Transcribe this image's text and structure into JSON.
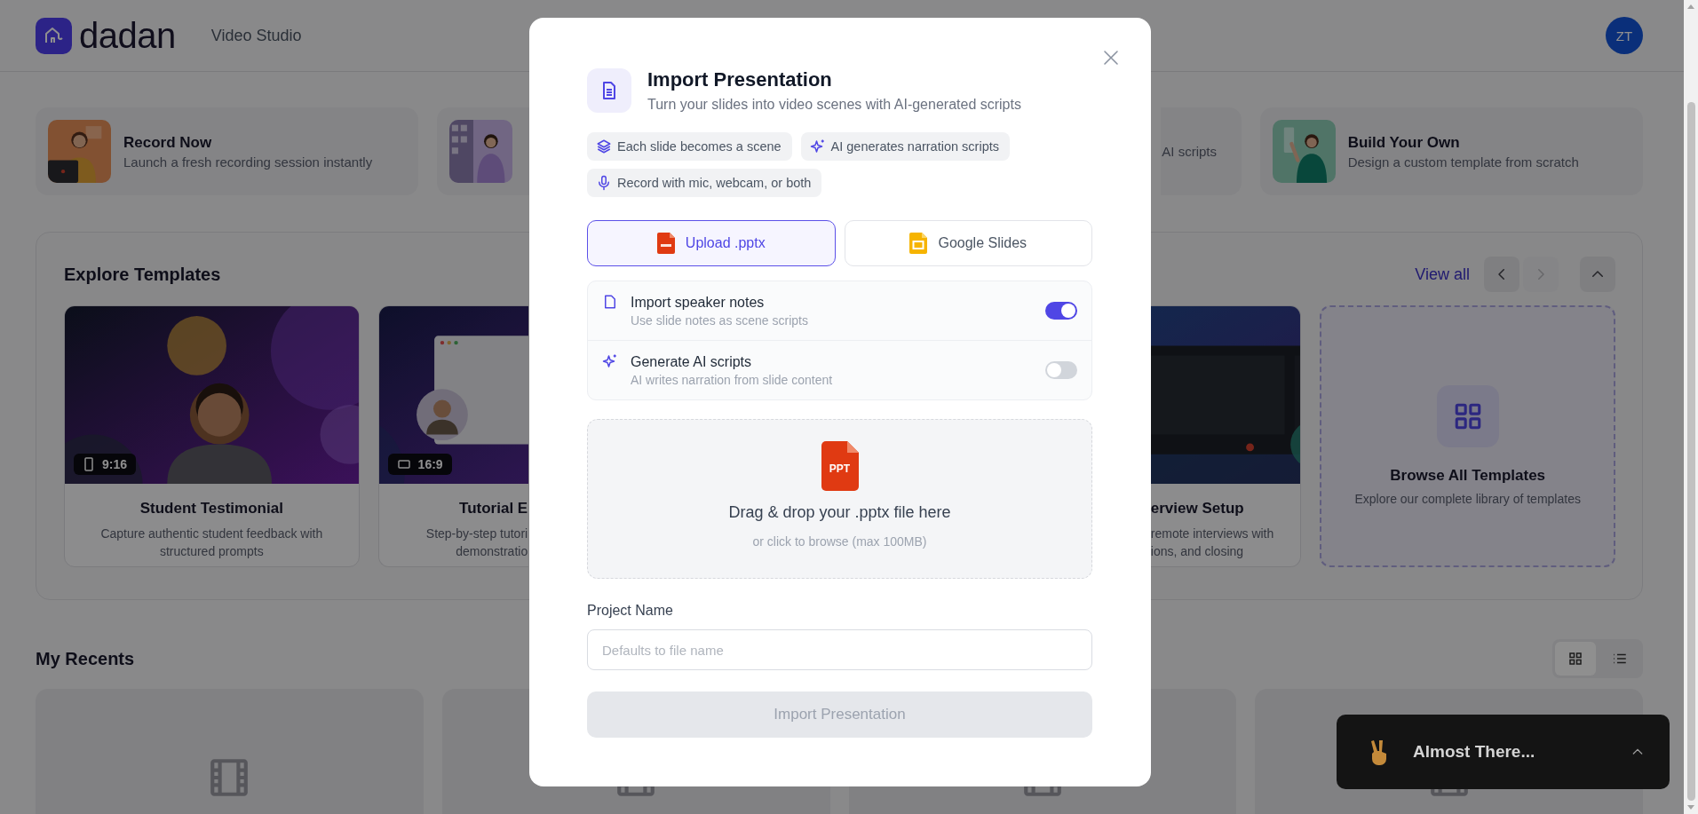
{
  "header": {
    "logo_text": "dadan",
    "section": "Video Studio",
    "avatar": "ZT"
  },
  "quick_actions": [
    {
      "kind": "whole",
      "title": "Record Now",
      "subtitle": "Launch a fresh recording session instantly"
    },
    {
      "kind": "cut_right"
    },
    {
      "kind": "cut_left",
      "subtitle": "AI scripts"
    },
    {
      "kind": "whole",
      "title": "Build Your Own",
      "subtitle": "Design a custom template from scratch"
    }
  ],
  "templates": {
    "title": "Explore Templates",
    "view_all": "View all",
    "nav": [
      {
        "kind": "prev",
        "disabled": false
      },
      {
        "kind": "next",
        "disabled": true
      },
      {
        "kind": "collapse",
        "disabled": false
      }
    ],
    "cards": [
      {
        "kind": "whole",
        "title": "Student Testimonial",
        "description_lines": [
          "Capture authentic student feedback with",
          "structured prompts"
        ],
        "ratio": {
          "kind": "portrait",
          "label": "9:16"
        }
      },
      {
        "kind": "cut_right",
        "title": "Tutorial E",
        "description_lines": [
          "Step-by-step tutori",
          "demonstratio"
        ],
        "ratio": {
          "kind": "landscape",
          "label": "16:9"
        }
      },
      {
        "kind": "cut_left",
        "title": "erview Setup",
        "description_lines": [
          "remote interviews with",
          "ions, and closing"
        ]
      }
    ],
    "browse": {
      "title": "Browse All Templates",
      "subtitle": "Explore our complete library of templates"
    }
  },
  "recents": {
    "title": "My Recents",
    "views": [
      {
        "kind": "grid",
        "selected": true
      },
      {
        "kind": "list",
        "selected": false
      }
    ],
    "items": [
      {
        "kind": "video"
      },
      {
        "kind": "video"
      },
      {
        "kind": "video"
      },
      {
        "kind": "video"
      }
    ]
  },
  "modal": {
    "title": "Import Presentation",
    "subtitle": "Turn your slides into video scenes with AI-generated scripts",
    "chips": [
      {
        "kind": "layers",
        "label": "Each slide becomes a scene"
      },
      {
        "kind": "sparkle",
        "label": "AI generates narration scripts"
      },
      {
        "kind": "mic",
        "label": "Record with mic, webcam, or both"
      }
    ],
    "source_tabs": [
      {
        "kind": "ppt",
        "label": "Upload .pptx",
        "selected": true
      },
      {
        "kind": "slides",
        "label": "Google Slides",
        "selected": false
      }
    ],
    "options": [
      {
        "kind": "notes",
        "title": "Import speaker notes",
        "subtitle": "Use slide notes as scene scripts",
        "on": true
      },
      {
        "kind": "sparkle",
        "title": "Generate AI scripts",
        "subtitle": "AI writes narration from slide content",
        "on": false
      }
    ],
    "dropzone": {
      "badge": "PPT",
      "title": "Drag & drop your .pptx file here",
      "hint": "or click to browse (max 100MB)"
    },
    "project_name": {
      "label": "Project Name",
      "placeholder": "Defaults to file name"
    },
    "import_button": {
      "label": "Import Presentation",
      "disabled": true
    }
  },
  "toast": {
    "title": "Almost There..."
  }
}
